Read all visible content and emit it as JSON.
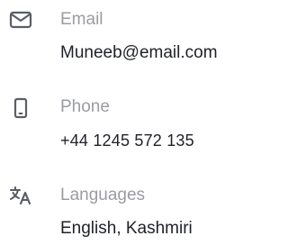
{
  "contact": {
    "email": {
      "icon": "envelope-icon",
      "label": "Email",
      "value": "Muneeb@email.com"
    },
    "phone": {
      "icon": "smartphone-icon",
      "label": "Phone",
      "value": "+44 1245 572 135"
    },
    "languages": {
      "icon": "translate-icon",
      "label": "Languages",
      "value": "English, Kashmiri"
    }
  },
  "colors": {
    "icon": "#5b5e66",
    "label": "#9a9ca3",
    "value": "#1f2128",
    "background": "#ffffff"
  }
}
